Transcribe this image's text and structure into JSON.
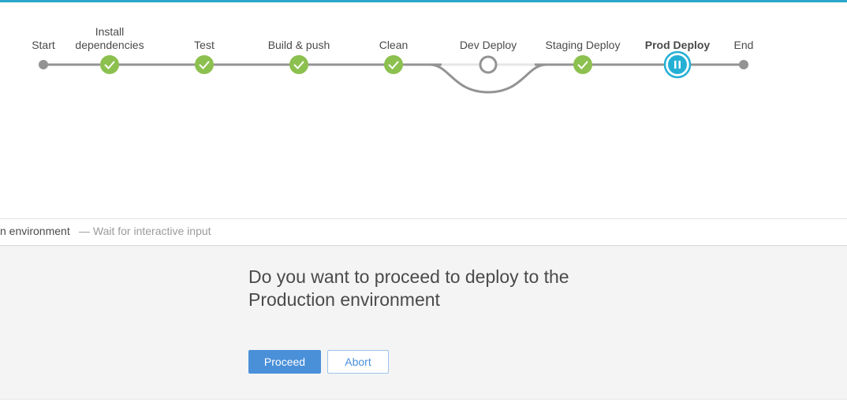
{
  "pipeline": {
    "stages": [
      {
        "label": "Start",
        "status": "start"
      },
      {
        "label": "Install\ndependencies",
        "status": "success"
      },
      {
        "label": "Test",
        "status": "success"
      },
      {
        "label": "Build & push",
        "status": "success"
      },
      {
        "label": "Clean",
        "status": "success"
      },
      {
        "label": "Dev Deploy",
        "status": "not-built"
      },
      {
        "label": "Staging Deploy",
        "status": "success"
      },
      {
        "label": "Prod Deploy",
        "status": "paused",
        "selected": true
      },
      {
        "label": "End",
        "status": "end"
      }
    ]
  },
  "step": {
    "name": "n environment",
    "status": "— Wait for interactive input"
  },
  "input": {
    "message": "Do you want to proceed to deploy to the Production environment",
    "proceed_label": "Proceed",
    "abort_label": "Abort"
  },
  "colors": {
    "accent": "#2ba6cb",
    "success": "#8cc04f",
    "paused": "#24b0d5",
    "track": "#949393",
    "primary_button": "#4a90d9"
  }
}
